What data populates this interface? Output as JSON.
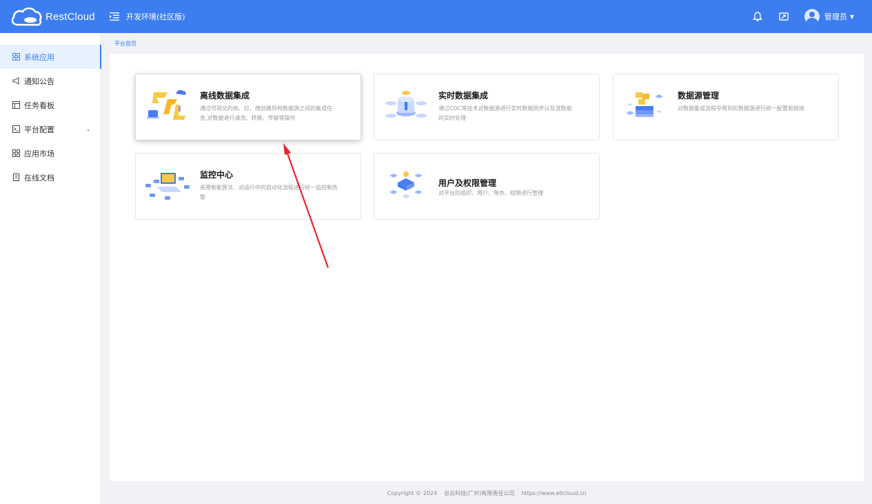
{
  "header": {
    "logo_text": "RestCloud",
    "env_label": "开发环境(社区版)",
    "user_name": "管理员"
  },
  "sidebar": {
    "items": [
      {
        "label": "系统应用",
        "icon": "grid-icon",
        "active": true
      },
      {
        "label": "通知公告",
        "icon": "megaphone-icon"
      },
      {
        "label": "任务看板",
        "icon": "board-icon"
      },
      {
        "label": "平台配置",
        "icon": "terminal-icon",
        "expandable": true
      },
      {
        "label": "应用市场",
        "icon": "grid-icon"
      },
      {
        "label": "在线文档",
        "icon": "document-icon"
      }
    ]
  },
  "breadcrumb": "平台首页",
  "cards": [
    {
      "title": "离线数据集成",
      "desc": "通过可视化的拖、拉、拽创建异构数据源之间的集成任务,对数据进行清洗、转换、传输等操作"
    },
    {
      "title": "实时数据集成",
      "desc": "通过CDC等技术对数据源进行实时数据同步以及流数据的实时处理"
    },
    {
      "title": "数据源管理",
      "desc": "对数据集成流程中用到的数据源进行统一配置和链接"
    },
    {
      "title": "监控中心",
      "desc": "采用智能算法、对运行中的自动化流程进行统一监控和告警"
    },
    {
      "title": "用户及权限管理",
      "desc": "对平台的组织、用户、角色、权限进行管理"
    }
  ],
  "footer": {
    "copyright": "Copyright © 2024",
    "company": "谷云科技(广州)有限责任公司",
    "url": "https://www.etlcloud.cn"
  },
  "colors": {
    "primary": "#3c7ef0",
    "annotation_arrow": "#e8242b"
  }
}
